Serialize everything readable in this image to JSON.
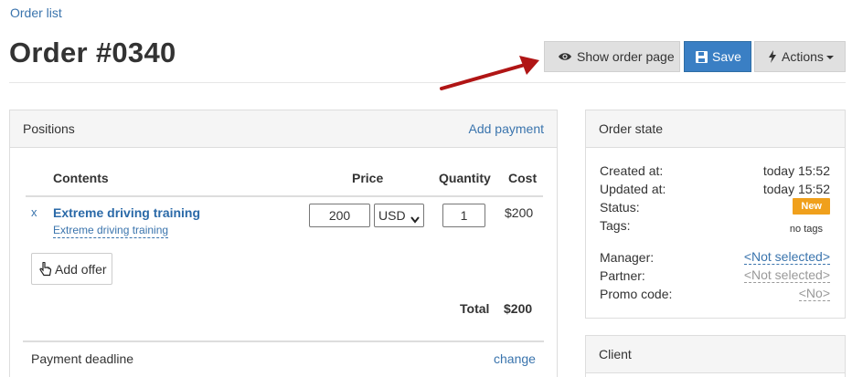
{
  "breadcrumb": {
    "label": "Order list"
  },
  "page": {
    "title": "Order #0340"
  },
  "toolbar": {
    "show_order_page": "Show order page",
    "save": "Save",
    "actions": "Actions"
  },
  "positions": {
    "title": "Positions",
    "add_payment": "Add payment",
    "columns": {
      "contents": "Contents",
      "price": "Price",
      "quantity": "Quantity",
      "cost": "Cost"
    },
    "items": [
      {
        "remove": "x",
        "name": "Extreme driving training",
        "offer": "Extreme driving training",
        "price": "200",
        "currency": "USD",
        "quantity": "1",
        "cost": "$200"
      }
    ],
    "add_offer": "Add offer",
    "total_label": "Total",
    "total_value": "$200",
    "payment_deadline_label": "Payment deadline",
    "payment_deadline_change": "change"
  },
  "order_state": {
    "title": "Order state",
    "created_label": "Created at:",
    "created_value": "today 15:52",
    "updated_label": "Updated at:",
    "updated_value": "today 15:52",
    "status_label": "Status:",
    "status_value": "New",
    "tags_label": "Tags:",
    "tags_value": "no tags",
    "manager_label": "Manager:",
    "manager_value": "<Not selected>",
    "partner_label": "Partner:",
    "partner_value": "<Not selected>",
    "promo_label": "Promo code:",
    "promo_value": "<No>"
  },
  "client": {
    "title": "Client"
  },
  "colors": {
    "link": "#3a74ad",
    "primary_button": "#3a7fc4",
    "status_new": "#f0a01c",
    "annotation_arrow": "#b01515"
  },
  "icons": {
    "show_order_page": "eye-icon",
    "save": "floppy-disk-icon",
    "actions": "lightning-bolt-icon",
    "add_offer": "hand-pointer-icon",
    "annotation": "red-arrow-icon"
  }
}
